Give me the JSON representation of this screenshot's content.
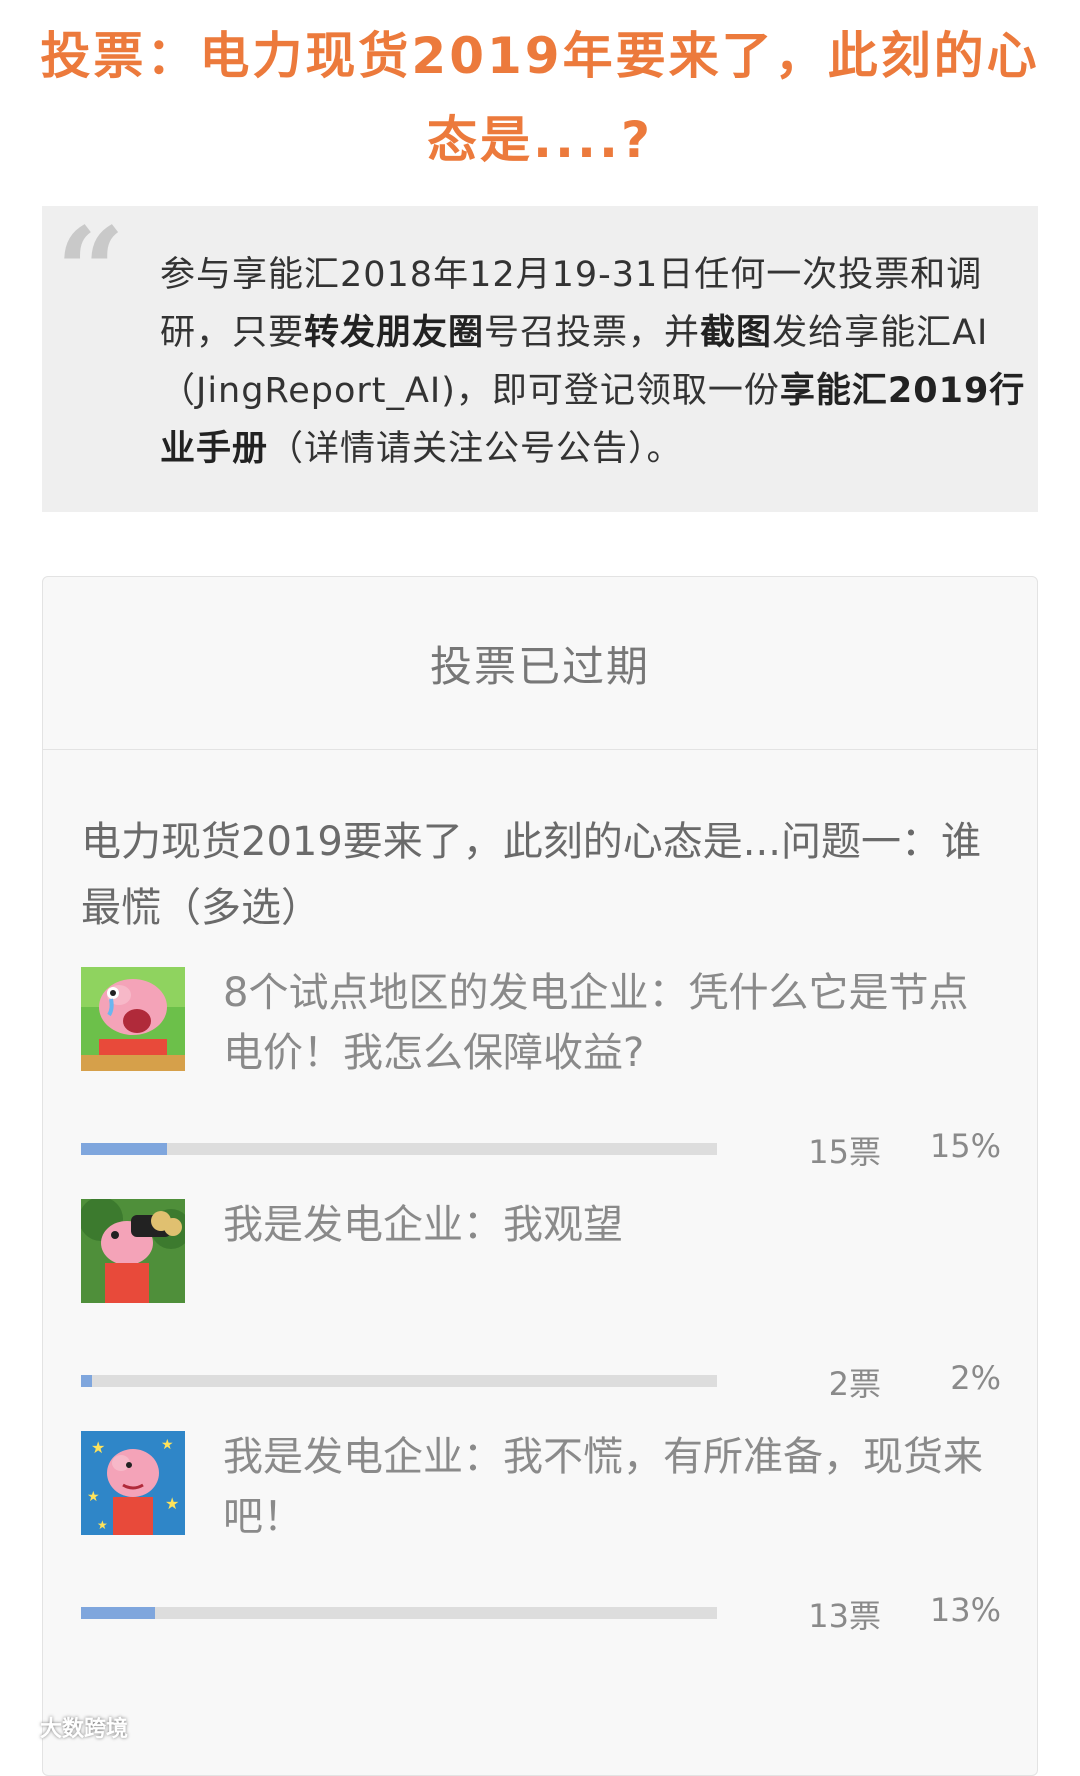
{
  "article": {
    "title": "投票：电力现货2019年要来了，此刻的心态是....?"
  },
  "notice": {
    "icon": "quote-mark-icon",
    "text_1": "参与享能汇2018年12月19-31日任何一次投票和调研，只要",
    "bold_1": "转发朋友圈",
    "text_2": "号召投票，并",
    "bold_2": "截图",
    "text_3": "发给享能汇AI（JingReport_AI)，即可登记领取一份",
    "bold_3": "享能汇2019行业手册",
    "text_4": "（详情请关注公号公告）。"
  },
  "vote": {
    "status": "投票已过期",
    "question": "电力现货2019要来了，此刻的心态是...问题一：谁最慌（多选）",
    "bar_color": "#7fa6dd",
    "options": [
      {
        "label": "8个试点地区的发电企业：凭什么它是节点电价！我怎么保障收益?",
        "votes": "15票",
        "percent": "15%",
        "fraction": 0.15,
        "thumb": "peppa-crying-thumbnail"
      },
      {
        "label": "我是发电企业：我观望",
        "votes": "2票",
        "percent": "2%",
        "fraction": 0.02,
        "thumb": "peppa-binoculars-thumbnail"
      },
      {
        "label": "我是发电企业：我不慌，有所准备，现货来吧！",
        "votes": "13票",
        "percent": "13%",
        "fraction": 0.13,
        "thumb": "peppa-stars-thumbnail"
      }
    ]
  },
  "watermark": {
    "text": "大数跨境"
  }
}
